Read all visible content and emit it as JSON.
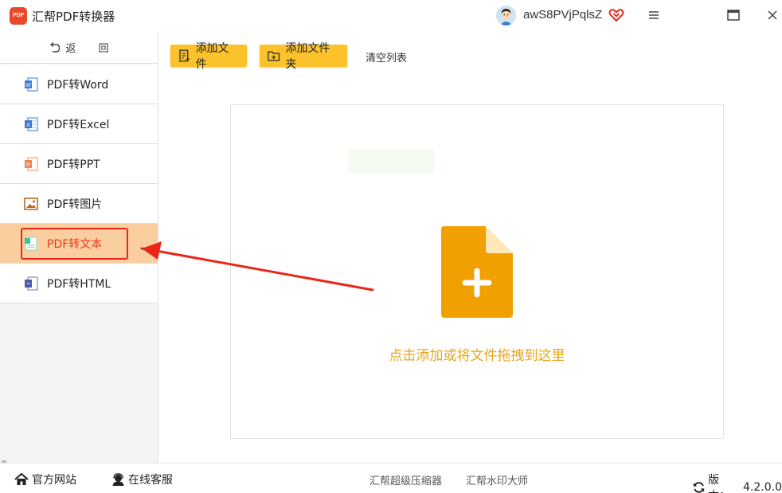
{
  "app": {
    "logo_text": "PDF",
    "title": "汇帮PDF转换器"
  },
  "user": {
    "name": "awS8PVjPqlsZ"
  },
  "icons": {
    "app_logo": "pdf-logo-icon",
    "vip": "heart-vip-icon",
    "menu": "hamburger-menu-icon",
    "maximize": "maximize-icon",
    "close": "close-icon",
    "back": "undo-arrow-icon",
    "drop": "file-plus-icon",
    "refresh": "refresh-icon"
  },
  "colors": {
    "accent": "#fbc22b",
    "active_bg": "#fbcea0",
    "active_text": "#e53a1d",
    "hint": "#e7a51d",
    "file_icon": "#f0a000",
    "annotation": "#e8271a"
  },
  "sidebar": {
    "back_label": "返 回",
    "items": [
      {
        "label": "PDF转Word",
        "icon": "word-icon"
      },
      {
        "label": "PDF转Excel",
        "icon": "excel-icon"
      },
      {
        "label": "PDF转PPT",
        "icon": "ppt-icon"
      },
      {
        "label": "PDF转图片",
        "icon": "image-icon"
      },
      {
        "label": "PDF转文本",
        "icon": "text-file-icon",
        "active": true
      },
      {
        "label": "PDF转HTML",
        "icon": "html-icon"
      }
    ]
  },
  "toolbar": {
    "add_file": "添加文件",
    "add_folder": "添加文件夹",
    "clear_list": "清空列表"
  },
  "dropzone": {
    "hint": "点击添加或将文件拖拽到这里"
  },
  "footer": {
    "website": "官方网站",
    "support": "在线客服",
    "link1": "汇帮超级压缩器",
    "link2": "汇帮水印大师",
    "version_label": "版本：",
    "version_value": "4.2.0.0"
  }
}
